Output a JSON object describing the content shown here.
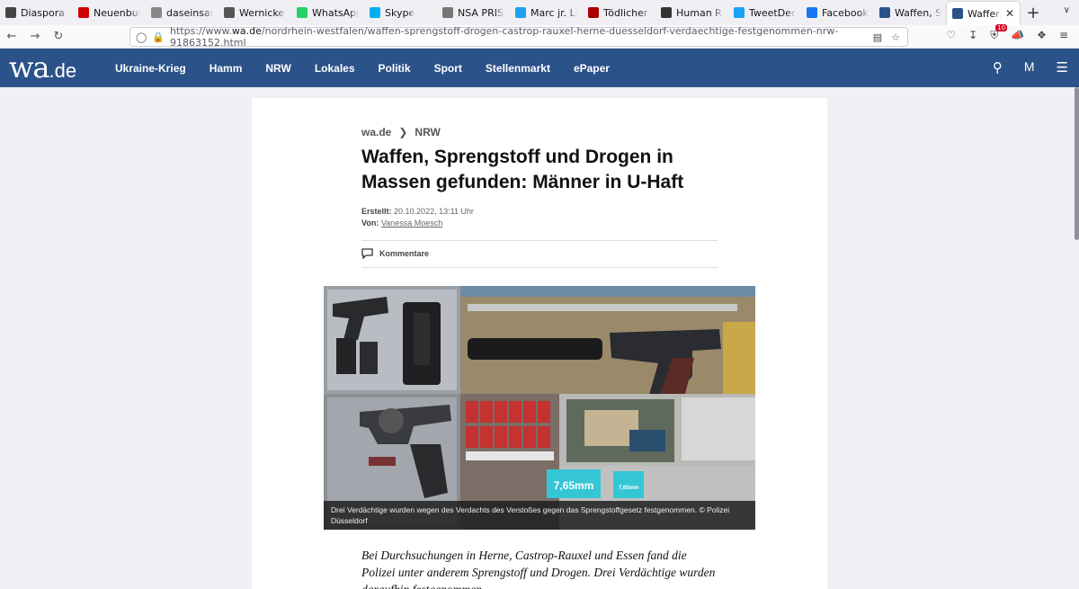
{
  "browser": {
    "tabs": [
      {
        "label": "Diaspora Eur",
        "favicon_color": "#444"
      },
      {
        "label": "Neuenburger",
        "favicon_color": "#c00"
      },
      {
        "label": "daseinsanalyse",
        "favicon_color": "#888"
      },
      {
        "label": "Wernicke-Ze",
        "favicon_color": "#555"
      },
      {
        "label": "WhatsApp",
        "favicon_color": "#25d366"
      },
      {
        "label": "Skype",
        "favicon_color": "#00aff0"
      },
      {
        "label": "NSA PRISM",
        "favicon_color": "#777"
      },
      {
        "label": "Marc jr. Land",
        "favicon_color": "#1da1f2"
      },
      {
        "label": "Tödlicher Am",
        "favicon_color": "#a00"
      },
      {
        "label": "Human Righ",
        "favicon_color": "#333"
      },
      {
        "label": "TweetDeck",
        "favicon_color": "#1da1f2"
      },
      {
        "label": "Facebook",
        "favicon_color": "#1877f2"
      },
      {
        "label": "Waffen, Spre",
        "favicon_color": "#2b5289"
      },
      {
        "label": "Waffen, Sp",
        "favicon_color": "#2b5289",
        "active": true
      }
    ],
    "url_prefix": "https://www.",
    "url_host": "wa.de",
    "url_path": "/nordrhein-westfalen/waffen-sprengstoff-drogen-castrop-rauxel-herne-duesseldorf-verdaechtige-festgenommen-nrw-91863152.html",
    "addon_badge": "10"
  },
  "site": {
    "logo_main": "wa",
    "logo_suffix": ".de",
    "brand_color": "#2b5289",
    "nav": [
      "Ukraine-Krieg",
      "Hamm",
      "NRW",
      "Lokales",
      "Politik",
      "Sport",
      "Stellenmarkt",
      "ePaper"
    ]
  },
  "article": {
    "breadcrumb": [
      "wa.de",
      "NRW"
    ],
    "title": "Waffen, Sprengstoff und Drogen in Massen gefunden: Männer in U-Haft",
    "created_label": "Erstellt:",
    "created_value": "20.10.2022, 13:11 Uhr",
    "author_label": "Von:",
    "author": "Vanessa Moesch",
    "comments_label": "Kommentare",
    "photo_caption": "Drei Verdächtige wurden wegen des Verdachts des Verstoßes gegen das Sprengstoffgesetz festgenommen. © Polizei Düsseldorf",
    "photo_text_box1": "7,65mm",
    "photo_text_box2": "7,65mm",
    "lead": "Bei Durchsuchungen in Herne, Castrop-Rauxel und Essen fand die Polizei unter anderem Sprengstoff und Drogen. Drei Verdächtige wurden daraufhin festgenommen."
  }
}
